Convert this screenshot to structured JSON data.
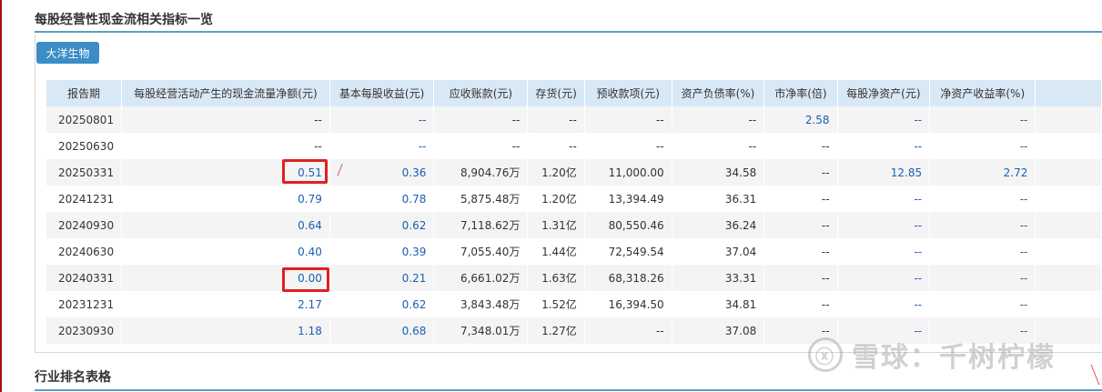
{
  "section_title": "每股经营性现金流相关指标一览",
  "company_button": "大洋生物",
  "table": {
    "headers": [
      "报告期",
      "每股经营活动产生的现金流量净额(元)",
      "基本每股收益(元)",
      "应收账款(元)",
      "存货(元)",
      "预收款项(元)",
      "资产负债率(%)",
      "市净率(倍)",
      "每股净资产(元)",
      "净资产收益率(%)"
    ],
    "rows": [
      [
        "20250801",
        "--",
        "--",
        "--",
        "--",
        "--",
        "--",
        "2.58",
        "--",
        "--"
      ],
      [
        "20250630",
        "--",
        "--",
        "--",
        "--",
        "--",
        "--",
        "--",
        "--",
        "--"
      ],
      [
        "20250331",
        "0.51",
        "0.36",
        "8,904.76万",
        "1.20亿",
        "11,000.00",
        "34.58",
        "--",
        "12.85",
        "2.72"
      ],
      [
        "20241231",
        "0.79",
        "0.78",
        "5,875.48万",
        "1.20亿",
        "13,394.49",
        "36.31",
        "--",
        "--",
        "--"
      ],
      [
        "20240930",
        "0.64",
        "0.62",
        "7,118.62万",
        "1.31亿",
        "80,550.46",
        "36.24",
        "--",
        "--",
        "--"
      ],
      [
        "20240630",
        "0.40",
        "0.39",
        "7,055.40万",
        "1.44亿",
        "72,549.54",
        "37.04",
        "--",
        "--",
        "--"
      ],
      [
        "20240331",
        "0.00",
        "0.21",
        "6,661.02万",
        "1.63亿",
        "68,318.26",
        "33.31",
        "--",
        "--",
        "--"
      ],
      [
        "20231231",
        "2.17",
        "0.62",
        "3,843.48万",
        "1.52亿",
        "16,394.50",
        "34.81",
        "--",
        "--",
        "--"
      ],
      [
        "20230930",
        "1.18",
        "0.68",
        "7,348.01万",
        "1.27亿",
        "--",
        "37.08",
        "--",
        "--",
        "--"
      ]
    ]
  },
  "section2_title": "行业排名表格",
  "watermark_text": "雪球：千树柠檬",
  "watermark_logo": "ⓧ",
  "colors": {
    "accent": "#3a8dc5",
    "link": "#1a5fb4",
    "highlight": "#e02020"
  }
}
